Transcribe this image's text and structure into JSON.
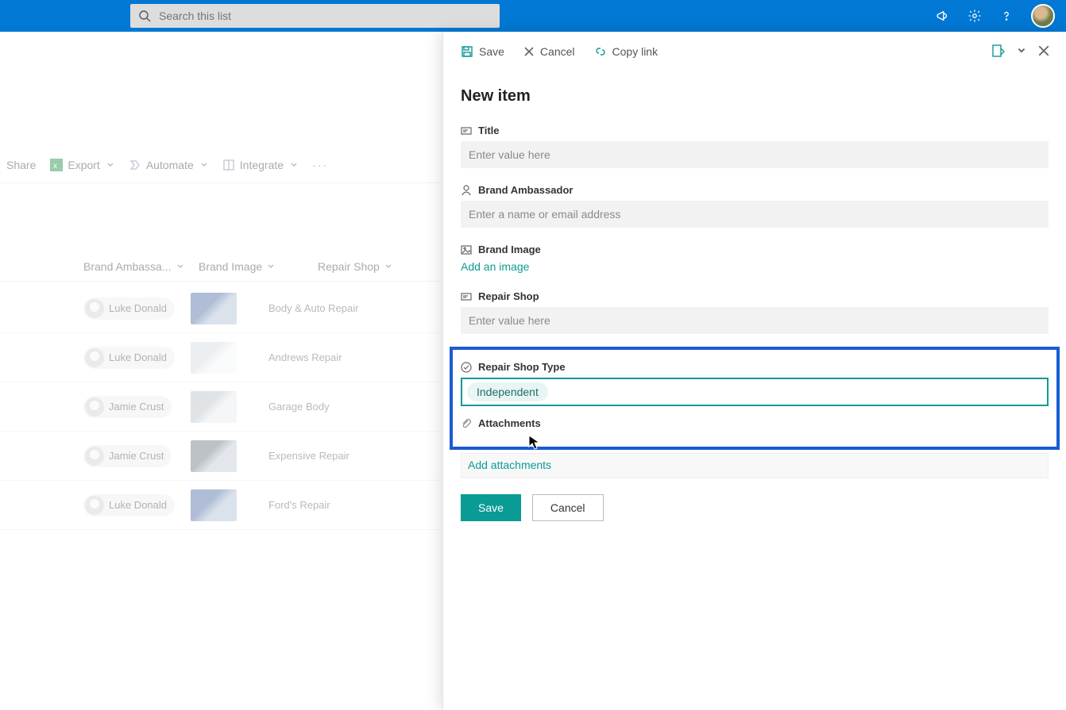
{
  "header": {
    "search_placeholder": "Search this list"
  },
  "toolbar": {
    "share": "Share",
    "export": "Export",
    "automate": "Automate",
    "integrate": "Integrate"
  },
  "columns": {
    "ambassador": "Brand Ambassa...",
    "image": "Brand Image",
    "repair": "Repair Shop"
  },
  "rows": [
    {
      "name": "Luke Donald",
      "repair": "Body & Auto Repair",
      "thumb": "blue"
    },
    {
      "name": "Luke Donald",
      "repair": "Andrews Repair",
      "thumb": "white"
    },
    {
      "name": "Jamie Crust",
      "repair": "Garage Body",
      "thumb": "silver"
    },
    {
      "name": "Jamie Crust",
      "repair": "Expensive Repair",
      "thumb": "grey"
    },
    {
      "name": "Luke Donald",
      "repair": "Ford's Repair",
      "thumb": "blue"
    }
  ],
  "panel": {
    "cmd_save": "Save",
    "cmd_cancel": "Cancel",
    "cmd_copylink": "Copy link",
    "title": "New item",
    "fields": {
      "title_label": "Title",
      "title_placeholder": "Enter value here",
      "ambassador_label": "Brand Ambassador",
      "ambassador_placeholder": "Enter a name or email address",
      "image_label": "Brand Image",
      "image_link": "Add an image",
      "repair_label": "Repair Shop",
      "repair_placeholder": "Enter value here",
      "shoptype_label": "Repair Shop Type",
      "shoptype_value": "Independent",
      "attachments_label": "Attachments",
      "attachments_link": "Add attachments"
    },
    "save_btn": "Save",
    "cancel_btn": "Cancel"
  }
}
